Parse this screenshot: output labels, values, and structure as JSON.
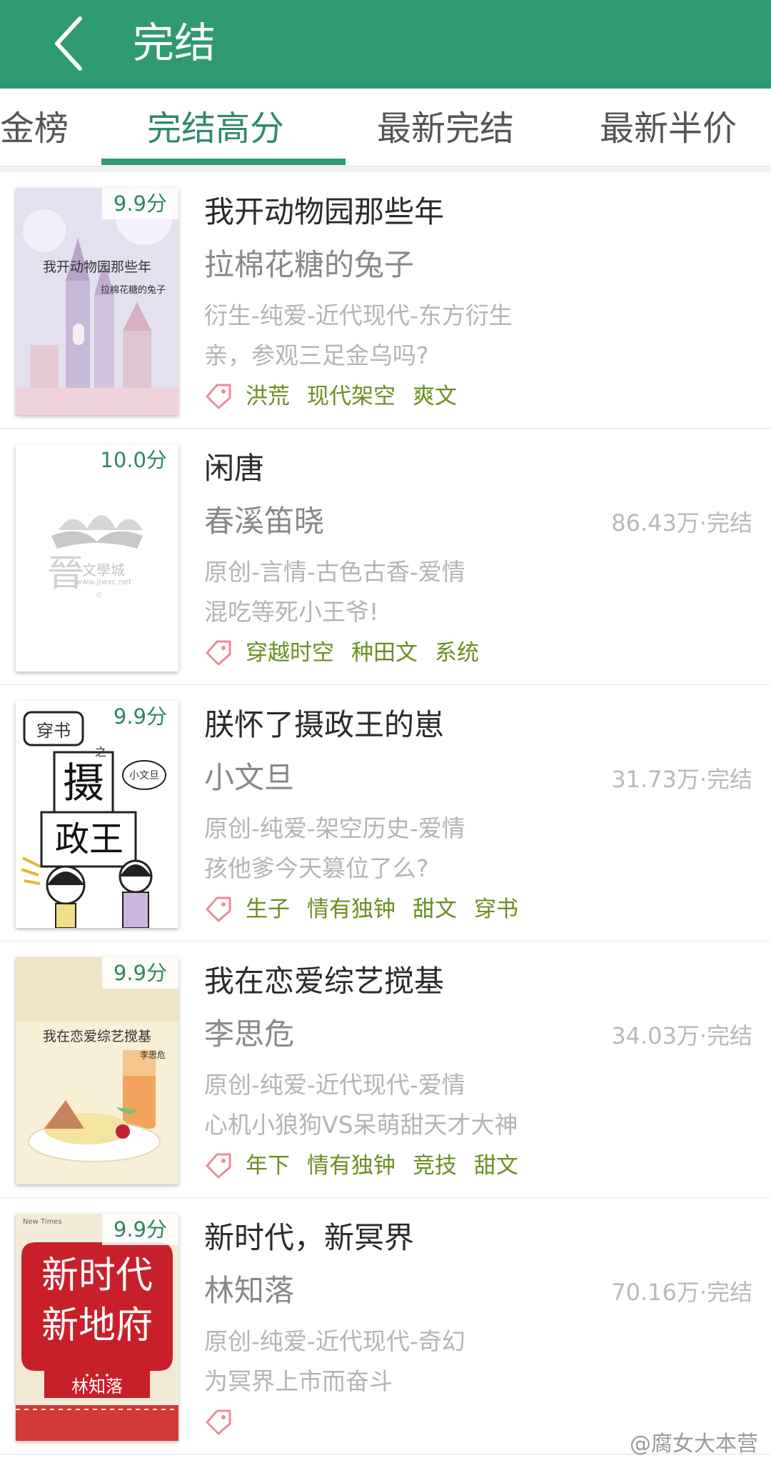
{
  "header": {
    "back_icon": "back-arrow-icon",
    "title": "完结"
  },
  "tabs": [
    {
      "label": "金榜",
      "active": false
    },
    {
      "label": "完结高分",
      "active": true
    },
    {
      "label": "最新完结",
      "active": false
    },
    {
      "label": "最新半价",
      "active": false
    }
  ],
  "books": [
    {
      "score": "9.9分",
      "cover_title": "我开动物园那些年",
      "cover_author": "拉棉花糖的兔子",
      "title": "我开动物园那些年",
      "author": "拉棉花糖的兔子",
      "words": "",
      "category": "衍生-纯爱-近代现代-东方衍生",
      "intro": "亲，参观三足金乌吗?",
      "tags": [
        "洪荒",
        "现代架空",
        "爽文"
      ]
    },
    {
      "score": "10.0分",
      "cover_logo": "文學城",
      "cover_url": "www.jjwxc.net",
      "title": "闲唐",
      "author": "春溪笛晓",
      "words": "86.43万·完结",
      "category": "原创-言情-古色古香-爱情",
      "intro": "混吃等死小王爷!",
      "tags": [
        "穿越时空",
        "种田文",
        "系统"
      ]
    },
    {
      "score": "9.9分",
      "cover_t1": "穿书",
      "cover_t2": "之",
      "cover_t3": "摄",
      "cover_t4": "政王",
      "cover_sig": "小文旦",
      "title": "朕怀了摄政王的崽",
      "author": "小文旦",
      "words": "31.73万·完结",
      "category": "原创-纯爱-架空历史-爱情",
      "intro": "孩他爹今天篡位了么?",
      "tags": [
        "生子",
        "情有独钟",
        "甜文",
        "穿书"
      ]
    },
    {
      "score": "9.9分",
      "cover_title": "我在恋爱综艺搅基",
      "cover_author": "李思危",
      "title": "我在恋爱综艺搅基",
      "author": "李思危",
      "words": "34.03万·完结",
      "category": "原创-纯爱-近代现代-爱情",
      "intro": "心机小狼狗VS呆萌甜天才大神",
      "tags": [
        "年下",
        "情有独钟",
        "竞技",
        "甜文"
      ]
    },
    {
      "score": "9.9分",
      "cover_top": "New Times",
      "cover_l1": "新时代",
      "cover_l2": "新地府",
      "cover_author": "林知落",
      "title": "新时代，新冥界",
      "author": "林知落",
      "words": "70.16万·完结",
      "category": "原创-纯爱-近代现代-奇幻",
      "intro": "为冥界上市而奋斗",
      "tags": []
    }
  ],
  "watermark": "@腐女大本营"
}
